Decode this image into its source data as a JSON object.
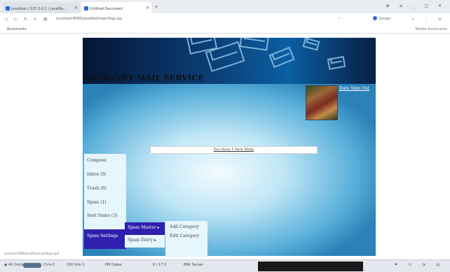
{
  "browser": {
    "tabs": [
      {
        "title": "localhost / 127.0.0.1 / javaMa..."
      },
      {
        "title": "Untitled Document"
      }
    ],
    "address": "localhost:8080/javaMail/mainPage.jsp",
    "search_placeholder": "Google",
    "bookmark": "Bookmarks",
    "bookmark_right": "Mobile bookmarks"
  },
  "page": {
    "title": "INTRANET MAIL SERVICE",
    "sign_out": "Date  Sign Out",
    "notice": "You Have 1 New Mails",
    "menu": [
      {
        "label": "Compose"
      },
      {
        "label": "Inbox (0)"
      },
      {
        "label": "Trash (0)"
      },
      {
        "label": "Spam (1)"
      },
      {
        "label": "Sent Items (3)"
      },
      {
        "label": "Spam Settings"
      }
    ],
    "spam_submenu": [
      {
        "label": "Spam Master ▸"
      },
      {
        "label": "Spam Entry ▸"
      }
    ],
    "category_submenu": [
      {
        "label": "Add Category"
      },
      {
        "label": "Edit Category"
      }
    ]
  },
  "status_url": "localhost:8080/javaMail/mainPage.jsp#",
  "taskbar": {
    "start": "All Contacts",
    "badge": "Ctrl+1",
    "item1": "ISO Sim 1",
    "item2": "PM Dates",
    "item3": "0 / 17 0",
    "item4": "BRK Server"
  },
  "colors": {
    "menu_selected": "#2f1fae",
    "menu_bg": "#e6f6fd",
    "banner": "#0c3f78"
  }
}
